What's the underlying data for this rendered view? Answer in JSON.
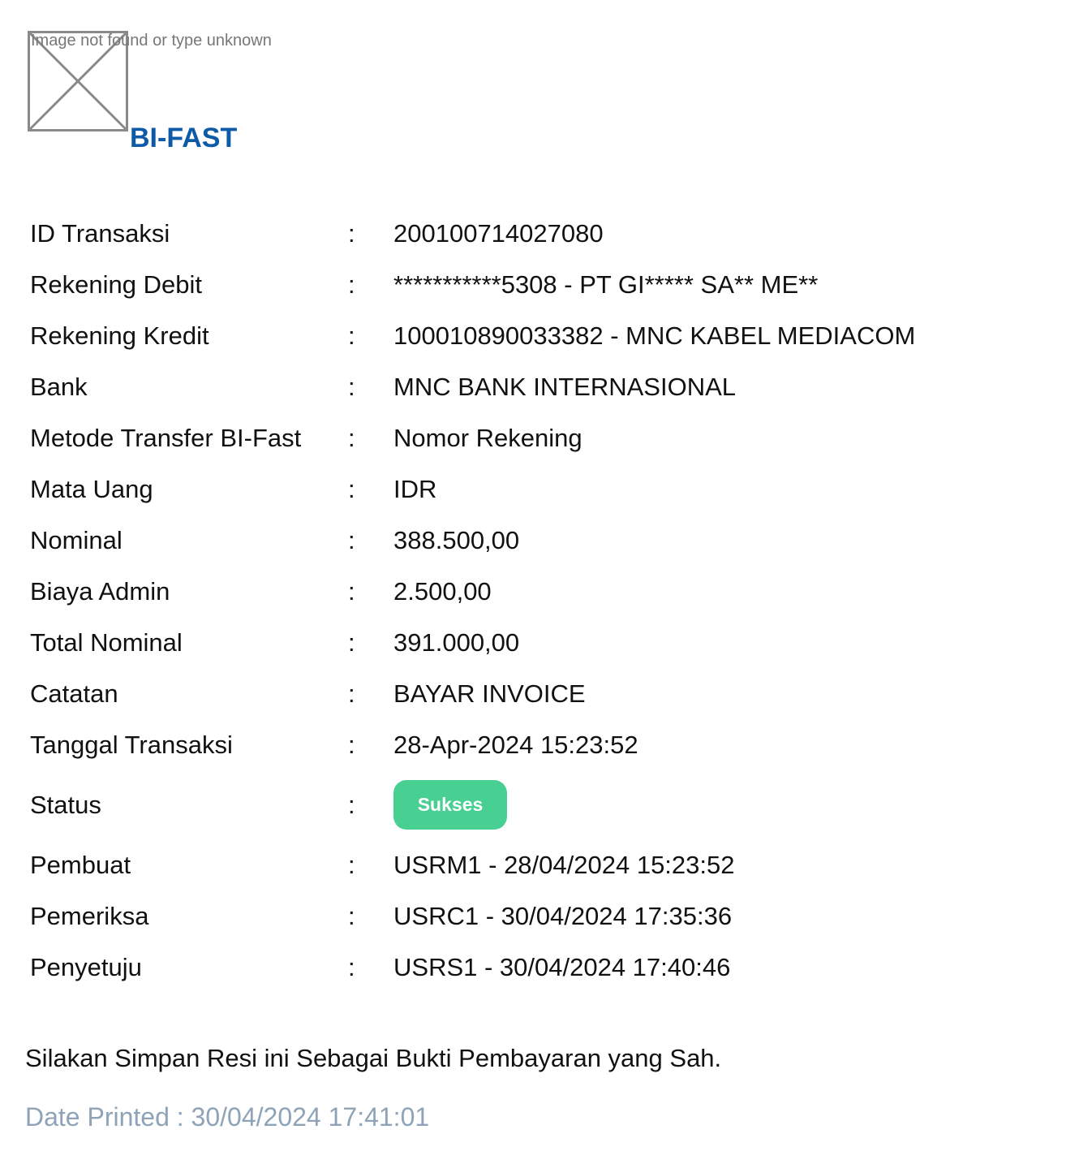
{
  "header": {
    "image_alt_text": "Image not found or type unknown",
    "brand": "BI-FAST"
  },
  "details": [
    {
      "label": "ID Transaksi",
      "value": "200100714027080"
    },
    {
      "label": "Rekening Debit",
      "value": "***********5308 - PT GI***** SA** ME**"
    },
    {
      "label": "Rekening Kredit",
      "value": "100010890033382 - MNC KABEL MEDIACOM"
    },
    {
      "label": "Bank",
      "value": "MNC BANK INTERNASIONAL"
    },
    {
      "label": "Metode Transfer BI-Fast",
      "value": "Nomor Rekening"
    },
    {
      "label": "Mata Uang",
      "value": "IDR"
    },
    {
      "label": "Nominal",
      "value": "388.500,00"
    },
    {
      "label": "Biaya Admin",
      "value": "2.500,00"
    },
    {
      "label": "Total Nominal",
      "value": "391.000,00"
    },
    {
      "label": "Catatan",
      "value": "BAYAR INVOICE"
    },
    {
      "label": "Tanggal Transaksi",
      "value": "28-Apr-2024 15:23:52"
    },
    {
      "label": "Status",
      "value": "Sukses"
    },
    {
      "label": "Pembuat",
      "value": "USRM1 - 28/04/2024 15:23:52"
    },
    {
      "label": "Pemeriksa",
      "value": "USRC1 - 30/04/2024 17:35:36"
    },
    {
      "label": "Penyetuju",
      "value": "USRS1 - 30/04/2024 17:40:46"
    }
  ],
  "separator": ":",
  "status_color": "#48d093",
  "brand_color": "#0d5aa7",
  "footer": {
    "notice": "Silakan Simpan Resi ini Sebagai Bukti Pembayaran yang Sah.",
    "printed_label": "Date Printed",
    "printed_value": "30/04/2024 17:41:01"
  }
}
